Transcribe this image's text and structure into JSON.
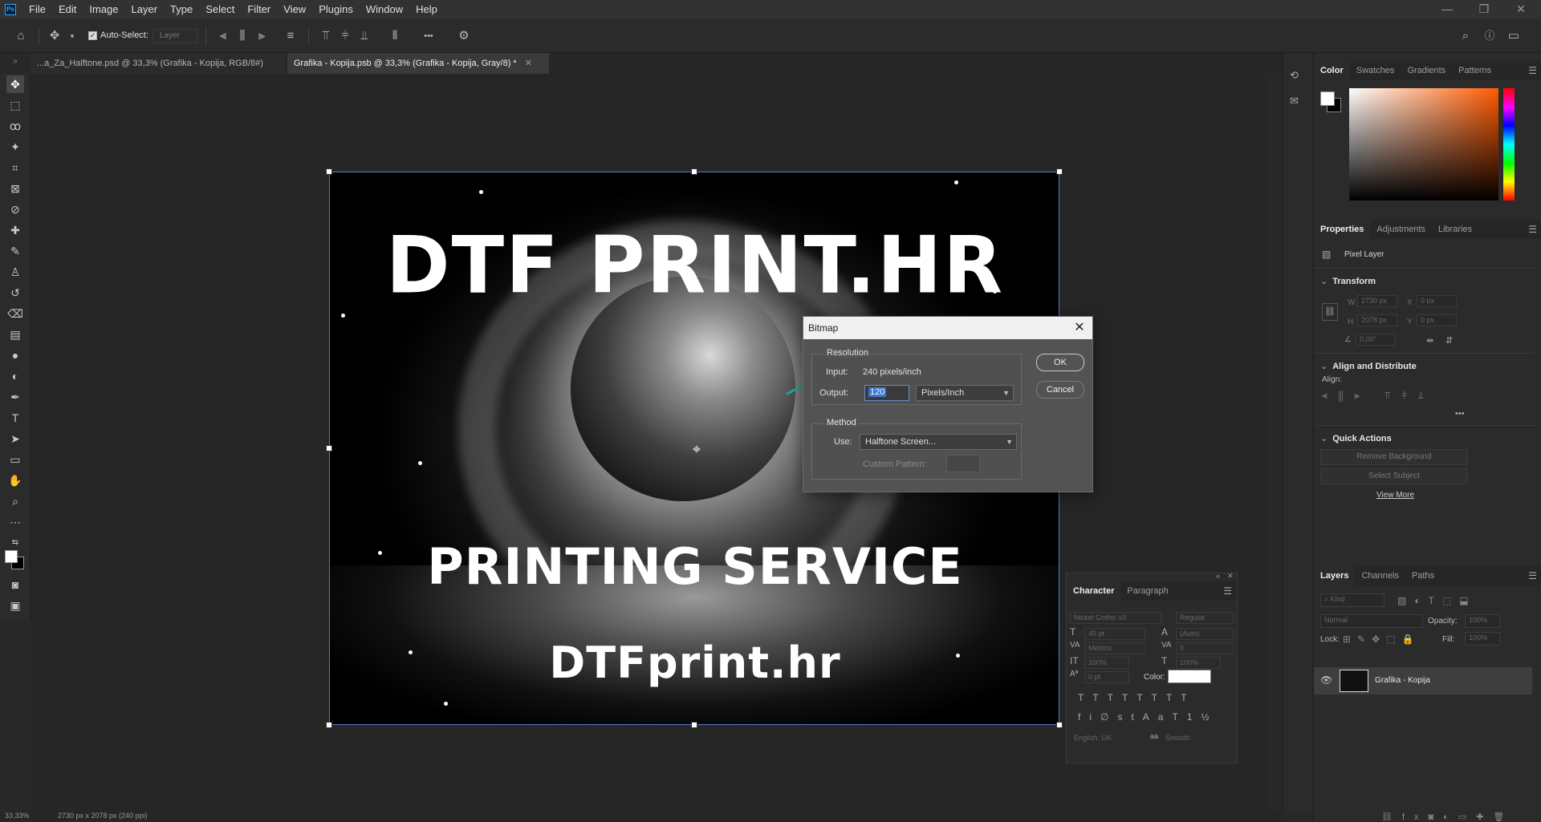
{
  "menubar": {
    "logo": "Ps",
    "items": [
      "File",
      "Edit",
      "Image",
      "Layer",
      "Type",
      "Select",
      "Filter",
      "View",
      "Plugins",
      "Window",
      "Help"
    ]
  },
  "options": {
    "auto_select_label": "Auto-Select:",
    "auto_select_value": "Layer",
    "more_label": "•••"
  },
  "tabs": [
    {
      "label": "...a_Za_Halftone.psd @ 33,3% (Grafika - Kopija, RGB/8#) *",
      "active": false
    },
    {
      "label": "Grafika - Kopija.psb @ 33,3% (Grafika - Kopija, Gray/8) *",
      "active": true
    }
  ],
  "artwork": {
    "title": "DTF PRINT.HR",
    "subtitle": "PRINTING SERVICE",
    "url": "DTFprint.hr"
  },
  "dialog": {
    "title": "Bitmap",
    "resolution_label": "Resolution",
    "input_label": "Input:",
    "input_value": "240 pixels/inch",
    "output_label": "Output:",
    "output_value": "120",
    "output_unit": "Pixels/Inch",
    "method_label": "Method",
    "use_label": "Use:",
    "use_value": "Halftone Screen...",
    "custom_pattern_label": "Custom Pattern:",
    "ok_label": "OK",
    "cancel_label": "Cancel"
  },
  "color_panel": {
    "tabs": [
      "Color",
      "Swatches",
      "Gradients",
      "Patterns"
    ],
    "foreground": "#ffffff",
    "background": "#000000"
  },
  "properties_panel": {
    "tabs": [
      "Properties",
      "Adjustments",
      "Libraries"
    ],
    "layer_type": "Pixel Layer",
    "transform_label": "Transform",
    "w_label": "W",
    "w_value": "2730 px",
    "h_label": "H",
    "h_value": "2078 px",
    "x_label": "X",
    "x_value": "0 px",
    "y_label": "Y",
    "y_value": "0 px",
    "angle_value": "0,00°",
    "align_distribute_label": "Align and Distribute",
    "align_label": "Align:",
    "quick_actions_label": "Quick Actions",
    "remove_bg_label": "Remove Background",
    "select_subject_label": "Select Subject",
    "view_more_label": "View More"
  },
  "character_panel": {
    "tabs": [
      "Character",
      "Paragraph"
    ],
    "font_family": "Nickel Gothic v3",
    "font_style": "Regular",
    "font_size": "45 pt",
    "leading": "(Auto)",
    "kerning": "Metrics",
    "tracking": "0",
    "vscale": "100%",
    "hscale": "100%",
    "baseline": "0 pt",
    "color_label": "Color:",
    "language": "English: UK",
    "aa_label": "aa",
    "antialias": "Smooth"
  },
  "layers_panel": {
    "tabs": [
      "Layers",
      "Channels",
      "Paths"
    ],
    "kind_placeholder": "Kind",
    "blend_mode": "Normal",
    "opacity_label": "Opacity:",
    "opacity_value": "100%",
    "lock_label": "Lock:",
    "fill_label": "Fill:",
    "fill_value": "100%",
    "layer_name": "Grafika - Kopija"
  },
  "status": {
    "zoom": "33,33%",
    "doc_info": "2730 px x 2078 px (240 ppi)"
  }
}
